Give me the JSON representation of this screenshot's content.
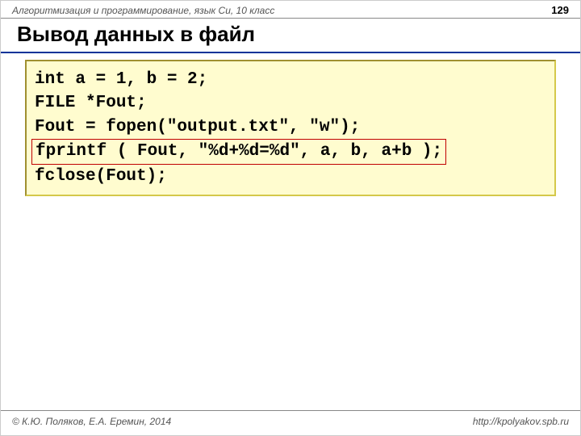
{
  "header": {
    "subject": "Алгоритмизация и программирование, язык Си, 10 класс",
    "page": "129"
  },
  "title": "Вывод данных в файл",
  "code": {
    "l1a": "int",
    "l1b": " a = 1, b = 2;",
    "l2": "FILE *Fout;",
    "l3a": "Fout = fopen(\"output.txt\", ",
    "l3b": "\"w\"",
    "l3c": ");",
    "l4a": "fprintf ( ",
    "l4b": "Fout,",
    "l4c": " \"%d+%d=%d\", a, b, a+b );",
    "l5": "fclose(Fout);"
  },
  "footer": {
    "left": "© К.Ю. Поляков, Е.А. Еремин, 2014",
    "right": "http://kpolyakov.spb.ru"
  }
}
